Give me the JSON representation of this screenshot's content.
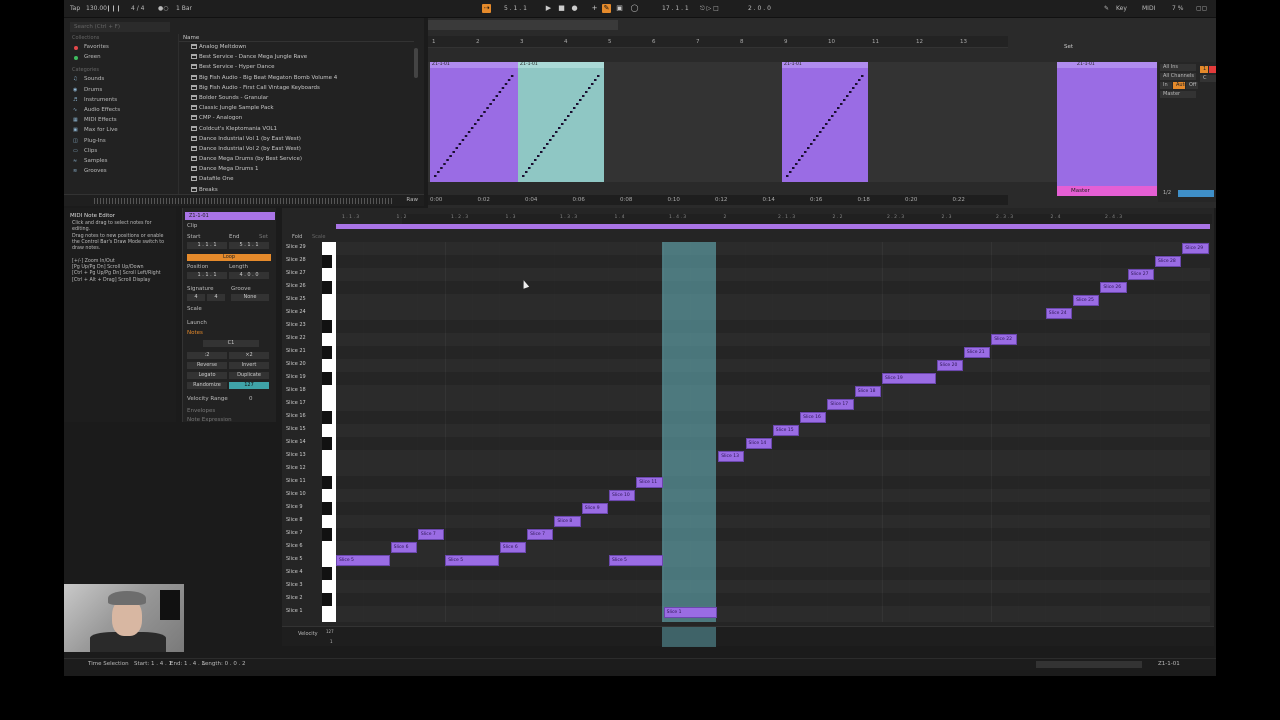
{
  "transport": {
    "tap": "Tap",
    "tempo": "130.00",
    "signature": "4 / 4",
    "quantize": "1 Bar",
    "position": "5 . 1 . 1",
    "loop_start": "17 . 1 . 1",
    "loop_length": "2 . 0 . 0",
    "key": "Key",
    "midi": "MIDI",
    "cpu": "7 %"
  },
  "browser": {
    "search_placeholder": "Search (Ctrl + F)",
    "collections_label": "Collections",
    "collections": [
      {
        "label": "Favorites",
        "color": "#e3484b"
      },
      {
        "label": "Green",
        "color": "#3fbd5f"
      }
    ],
    "categories_label": "Categories",
    "categories": [
      "Sounds",
      "Drums",
      "Instruments",
      "Audio Effects",
      "MIDI Effects",
      "Max for Live",
      "Plug-Ins",
      "Clips",
      "Samples",
      "Grooves"
    ],
    "name_header": "Name",
    "items": [
      "Analog Meltdown",
      "Best Service - Dance Mega Jungle Rave",
      "Best Service - Hyper Dance",
      "Big Fish Audio - Big Beat Megaton Bomb Volume 4",
      "Big Fish Audio - First Call Vintage Keyboards",
      "Bolder Sounds - Granular",
      "Classic Jungle Sample Pack",
      "CMP - Analogon",
      "Coldcut's Kleptomania VOL1",
      "Dance Industrial Vol 1 (by East West)",
      "Dance Industrial Vol 2 (by East West)",
      "Dance Mega Drums (by Best Service)",
      "Dance Mega Drums 1",
      "Datafile One",
      "Breaks"
    ],
    "preview_raw": "Raw"
  },
  "arrangement": {
    "ruler": [
      "1",
      "2",
      "3",
      "4",
      "5",
      "6",
      "7",
      "8",
      "9",
      "10",
      "11",
      "12",
      "13"
    ],
    "times": [
      "0:00",
      "0:02",
      "0:04",
      "0:06",
      "0:08",
      "0:10",
      "0:12",
      "0:14",
      "0:16",
      "0:18",
      "0:20",
      "0:22"
    ],
    "clip_name": "Z1-1-01",
    "set_label": "Set",
    "master_label": "Master",
    "mixer": {
      "input": "All Ins",
      "channel": "All Channels",
      "monitor_in": "In",
      "monitor_auto": "Auto",
      "monitor_off": "Off",
      "output": "Master",
      "track_number": "1",
      "track_value": "C",
      "page": "1/2"
    }
  },
  "note_editor_help": {
    "title": "MIDI Note Editor",
    "lines": [
      "Click and drag to select notes for editing.",
      "Drag notes to new positions or enable",
      "the Control Bar's Draw Mode switch to",
      "draw notes.",
      "",
      "[+/-] Zoom In/Out",
      "[Pg Up/Pg Dn] Scroll Up/Down",
      "[Ctrl + Pg Up/Pg Dn] Scroll Left/Right",
      "[Ctrl + Alt + Drag] Scroll Display"
    ]
  },
  "clip_view": {
    "title": "Z1-1-01",
    "clip_label": "Clip",
    "start_label": "Start",
    "end_label": "End",
    "set_label": "Set",
    "start_value": "1 . 1 . 1",
    "end_value": "5 . 1 . 1",
    "loop_label": "Loop",
    "position_label": "Position",
    "length_label": "Length",
    "position_value": "1 . 1 . 1",
    "length_value": "4 . 0 . 0",
    "signature_label": "Signature",
    "groove_label": "Groove",
    "sig_num": "4",
    "sig_den": "4",
    "groove_value": "None",
    "scale_label": "Scale",
    "launch_label": "Launch",
    "notes_label": "Notes",
    "root_note": "C1",
    "half": ":2",
    "double": "×2",
    "reverse": "Reverse",
    "invert": "Invert",
    "legato": "Legato",
    "duplicate": "Duplicate",
    "randomize": "Randomize",
    "randomize_value": "127",
    "velocity_range_label": "Velocity Range",
    "velocity_range_value": "0",
    "envelopes_label": "Envelopes",
    "note_expression_label": "Note Expression"
  },
  "piano_roll": {
    "fold": "Fold",
    "scale": "Scale",
    "ruler": [
      "1 . 1 . 3",
      "1 . 2",
      "1 . 2 . 3",
      "1 . 3",
      "1 . 3 . 3",
      "1 . 4",
      "1 . 4 . 3",
      "2",
      "2 . 1 . 3",
      "2 . 2",
      "2 . 2 . 3",
      "2 . 3",
      "2 . 3 . 3",
      "2 . 4",
      "2 . 4 . 3"
    ],
    "key_labels": [
      "Slice 29",
      "Slice 28",
      "Slice 27",
      "Slice 26",
      "Slice 25",
      "Slice 24",
      "Slice 23",
      "Slice 22",
      "Slice 21",
      "Slice 20",
      "Slice 19",
      "Slice 18",
      "Slice 17",
      "Slice 16",
      "Slice 15",
      "Slice 14",
      "Slice 13",
      "Slice 12",
      "Slice 11",
      "Slice 10",
      "Slice 9",
      "Slice 8",
      "Slice 7",
      "Slice 6",
      "Slice 5",
      "Slice 4",
      "Slice 3",
      "Slice 2",
      "Slice 1"
    ],
    "notes": [
      {
        "label": "Slice 5",
        "slice": 5,
        "start": 0,
        "len": 2
      },
      {
        "label": "Slice 6",
        "slice": 6,
        "start": 2,
        "len": 1
      },
      {
        "label": "Slice 7",
        "slice": 7,
        "start": 3,
        "len": 1
      },
      {
        "label": "Slice 5",
        "slice": 5,
        "start": 4,
        "len": 2
      },
      {
        "label": "Slice 6",
        "slice": 6,
        "start": 6,
        "len": 1
      },
      {
        "label": "Slice 7",
        "slice": 7,
        "start": 7,
        "len": 1
      },
      {
        "label": "Slice 8",
        "slice": 8,
        "start": 8,
        "len": 1
      },
      {
        "label": "Slice 9",
        "slice": 9,
        "start": 9,
        "len": 1
      },
      {
        "label": "Slice 10",
        "slice": 10,
        "start": 10,
        "len": 1
      },
      {
        "label": "Slice 5",
        "slice": 5,
        "start": 10,
        "len": 2
      },
      {
        "label": "Slice 11",
        "slice": 11,
        "start": 11,
        "len": 1
      },
      {
        "label": "Slice 1",
        "slice": 1,
        "start": 12,
        "len": 2
      },
      {
        "label": "Slice 13",
        "slice": 13,
        "start": 14,
        "len": 1
      },
      {
        "label": "Slice 14",
        "slice": 14,
        "start": 15,
        "len": 1
      },
      {
        "label": "Slice 15",
        "slice": 15,
        "start": 16,
        "len": 1
      },
      {
        "label": "Slice 16",
        "slice": 16,
        "start": 17,
        "len": 1
      },
      {
        "label": "Slice 17",
        "slice": 17,
        "start": 18,
        "len": 1
      },
      {
        "label": "Slice 18",
        "slice": 18,
        "start": 19,
        "len": 1
      },
      {
        "label": "Slice 19",
        "slice": 19,
        "start": 20,
        "len": 2
      },
      {
        "label": "Slice 20",
        "slice": 20,
        "start": 22,
        "len": 1
      },
      {
        "label": "Slice 21",
        "slice": 21,
        "start": 23,
        "len": 1
      },
      {
        "label": "Slice 22",
        "slice": 22,
        "start": 24,
        "len": 1
      },
      {
        "label": "Slice 24",
        "slice": 24,
        "start": 26,
        "len": 1
      },
      {
        "label": "Slice 25",
        "slice": 25,
        "start": 27,
        "len": 1
      },
      {
        "label": "Slice 26",
        "slice": 26,
        "start": 28,
        "len": 1
      },
      {
        "label": "Slice 27",
        "slice": 27,
        "start": 29,
        "len": 1
      },
      {
        "label": "Slice 28",
        "slice": 28,
        "start": 30,
        "len": 1
      },
      {
        "label": "Slice 29",
        "slice": 29,
        "start": 31,
        "len": 1
      }
    ],
    "velocity_label": "Velocity",
    "velocity_max": "127",
    "velocity_min": "1"
  },
  "status": {
    "mode": "Time Selection",
    "start": "Start: 1 . 4 . 1",
    "end": "End: 1 . 4 . 3",
    "length": "Length: 0 . 0 . 2",
    "track": "Z1-1-01"
  },
  "colors": {
    "clip": "#9a6ce4",
    "selection": "#8fc7c4",
    "accent": "#e58a2b",
    "master": "#e55fd4"
  }
}
